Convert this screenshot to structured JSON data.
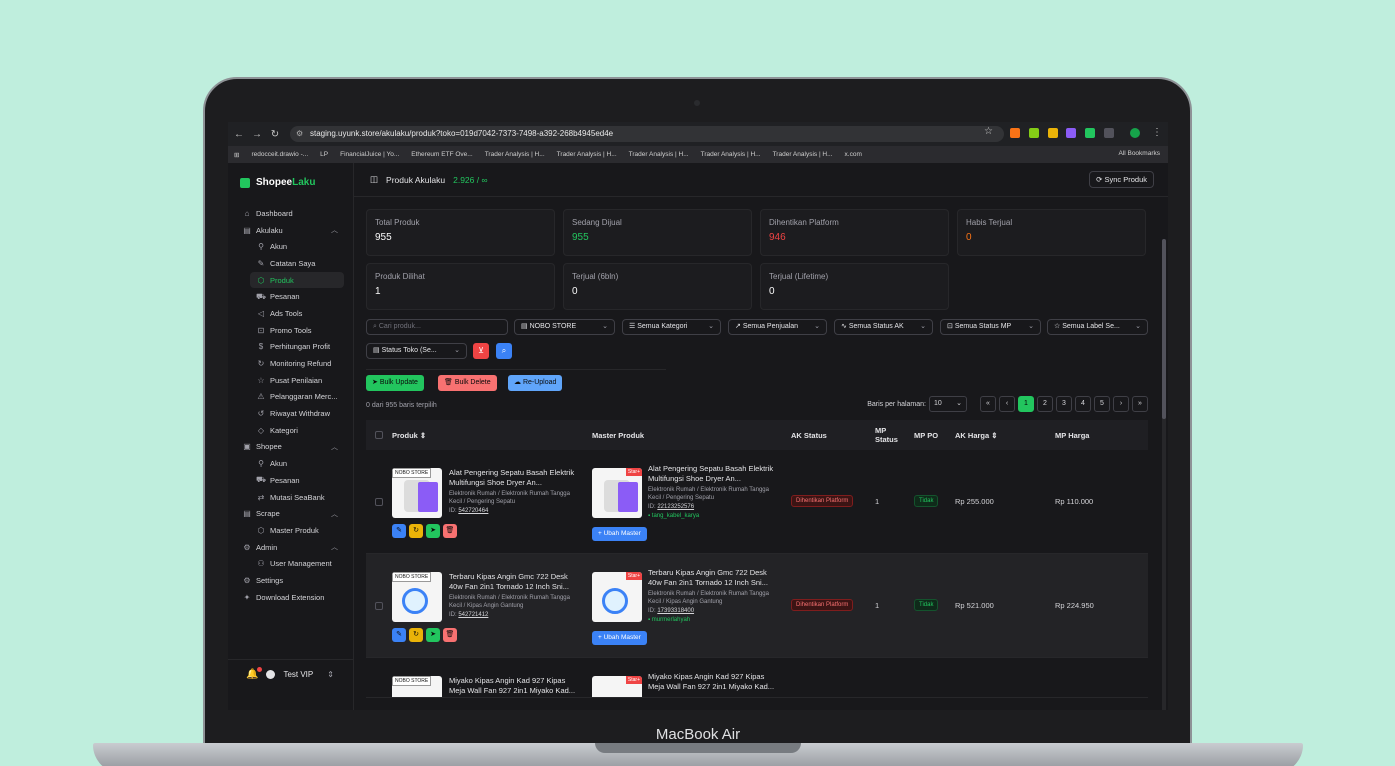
{
  "device": {
    "brand": "MacBook Air"
  },
  "browser": {
    "url": "staging.uyunk.store/akulaku/produk?toko=019d7042-7373-7498-a392-268b4945ed4e",
    "bookmarks": [
      "redocceit.drawio -...",
      "LP",
      "FinancialJuice | Yo...",
      "Ethereum ETF Ove...",
      "Trader Analysis | H...",
      "Trader Analysis | H...",
      "Trader Analysis | H...",
      "Trader Analysis | H...",
      "Trader Analysis | H...",
      "x.com"
    ],
    "all_bookmarks": "All Bookmarks"
  },
  "app": {
    "logo_a": "Shopee",
    "logo_b": "Laku"
  },
  "sidebar": {
    "items": [
      {
        "label": "Dashboard",
        "icon": "home-icon"
      },
      {
        "label": "Akulaku",
        "icon": "store-icon"
      },
      {
        "label": "Akun",
        "icon": "user-icon"
      },
      {
        "label": "Catatan Saya",
        "icon": "note-icon"
      },
      {
        "label": "Produk",
        "icon": "box-icon"
      },
      {
        "label": "Pesanan",
        "icon": "truck-icon"
      },
      {
        "label": "Ads Tools",
        "icon": "megaphone-icon"
      },
      {
        "label": "Promo Tools",
        "icon": "gift-icon"
      },
      {
        "label": "Perhitungan Profit",
        "icon": "dollar-icon"
      },
      {
        "label": "Monitoring Refund",
        "icon": "refresh-icon"
      },
      {
        "label": "Pusat Penilaian",
        "icon": "star-icon"
      },
      {
        "label": "Pelanggaran Merc...",
        "icon": "warning-icon"
      },
      {
        "label": "Riwayat Withdraw",
        "icon": "history-icon"
      },
      {
        "label": "Kategori",
        "icon": "tag-icon"
      },
      {
        "label": "Shopee",
        "icon": "bag-icon"
      },
      {
        "label": "Akun",
        "icon": "user-icon"
      },
      {
        "label": "Pesanan",
        "icon": "truck-icon"
      },
      {
        "label": "Mutasi SeaBank",
        "icon": "swap-icon"
      },
      {
        "label": "Scrape",
        "icon": "store-icon"
      },
      {
        "label": "Master Produk",
        "icon": "box-icon"
      },
      {
        "label": "Admin",
        "icon": "gear-icon"
      },
      {
        "label": "User Management",
        "icon": "users-icon"
      },
      {
        "label": "Settings",
        "icon": "gear-icon"
      },
      {
        "label": "Download Extension",
        "icon": "puzzle-icon"
      }
    ],
    "user": "Test VIP"
  },
  "header": {
    "title": "Produk Akulaku",
    "count": "2.926 / ∞",
    "sync_label": "Sync Produk"
  },
  "stats": [
    {
      "label": "Total Produk",
      "value": "955"
    },
    {
      "label": "Sedang Dijual",
      "value": "955"
    },
    {
      "label": "Dihentikan Platform",
      "value": "946"
    },
    {
      "label": "Habis Terjual",
      "value": "0"
    },
    {
      "label": "Produk Dilihat",
      "value": "1"
    },
    {
      "label": "Terjual (6bln)",
      "value": "0"
    },
    {
      "label": "Terjual (Lifetime)",
      "value": "0"
    }
  ],
  "filters": {
    "search_placeholder": "Cari produk...",
    "toko": "NOBO STORE",
    "kategori": "Semua Kategori",
    "penjualan": "Semua Penjualan",
    "status_ak": "Semua Status AK",
    "status_mp": "Semua Status MP",
    "label": "Semua Label Se...",
    "status_toko": "Status Toko (Se..."
  },
  "actions": {
    "bulk_update": "Bulk Update",
    "bulk_delete": "Bulk Delete",
    "reupload": "Re-Upload"
  },
  "selection": "0 dari 955 baris terpilih",
  "pagination": {
    "per_page_label": "Baris per halaman:",
    "per_page": "10",
    "pages": [
      "1",
      "2",
      "3",
      "4",
      "5"
    ]
  },
  "table": {
    "headers": [
      "Produk",
      "Master Produk",
      "AK Status",
      "MP Status",
      "MP PO",
      "AK Harga",
      "MP Harga"
    ],
    "rows": [
      {
        "tag": "NOBO STORE",
        "title": "Alat Pengering Sepatu Basah Elektrik Multifungsi Shoe Dryer An...",
        "cat": "Elektronik Rumah / Elektronik Rumah Tangga Kecil / Pengering Sepatu",
        "id_label": "ID: ",
        "id": "542720464",
        "m_title": "Alat Pengering Sepatu Basah Elektrik Multifungsi Shoe Dryer An...",
        "m_cat": "Elektronik Rumah / Elektronik Rumah Tangga Kecil / Pengering Sepatu",
        "m_id": "22123252576",
        "seller": "tang_kabel_karya",
        "star": "Star+",
        "ubah": "+ Ubah Master",
        "ak_status": "Dihentikan Platform",
        "mp_status": "1",
        "mp_po": "Tidak",
        "ak_harga": "Rp 255.000",
        "mp_harga": "Rp 110.000"
      },
      {
        "tag": "NOBO STORE",
        "title": "Terbaru Kipas Angin Gmc 722 Desk 40w Fan 2in1 Tornado 12 Inch Sni...",
        "cat": "Elektronik Rumah / Elektronik Rumah Tangga Kecil / Kipas Angin Gantung",
        "id_label": "ID: ",
        "id": "542721412",
        "m_title": "Terbaru Kipas Angin Gmc 722 Desk 40w Fan 2in1 Tornado 12 Inch Sni...",
        "m_cat": "Elektronik Rumah / Elektronik Rumah Tangga Kecil / Kipas Angin Gantung",
        "m_id": "17393318400",
        "seller": "murmerlahyah",
        "star": "Star+",
        "ubah": "+ Ubah Master",
        "ak_status": "Dihentikan Platform",
        "mp_status": "1",
        "mp_po": "Tidak",
        "ak_harga": "Rp 521.000",
        "mp_harga": "Rp 224.950"
      },
      {
        "tag": "NOBO STORE",
        "title": "Miyako Kipas Angin Kad 927 Kipas Meja Wall Fan 927 2in1 Miyako Kad...",
        "m_title": "Miyako Kipas Angin Kad 927 Kipas Meja Wall Fan 927 2in1 Miyako Kad...",
        "star": "Star+"
      }
    ]
  },
  "colors": {
    "accent": "#22c55e",
    "danger": "#ef4444",
    "warning": "#f97316",
    "info": "#3b82f6"
  }
}
